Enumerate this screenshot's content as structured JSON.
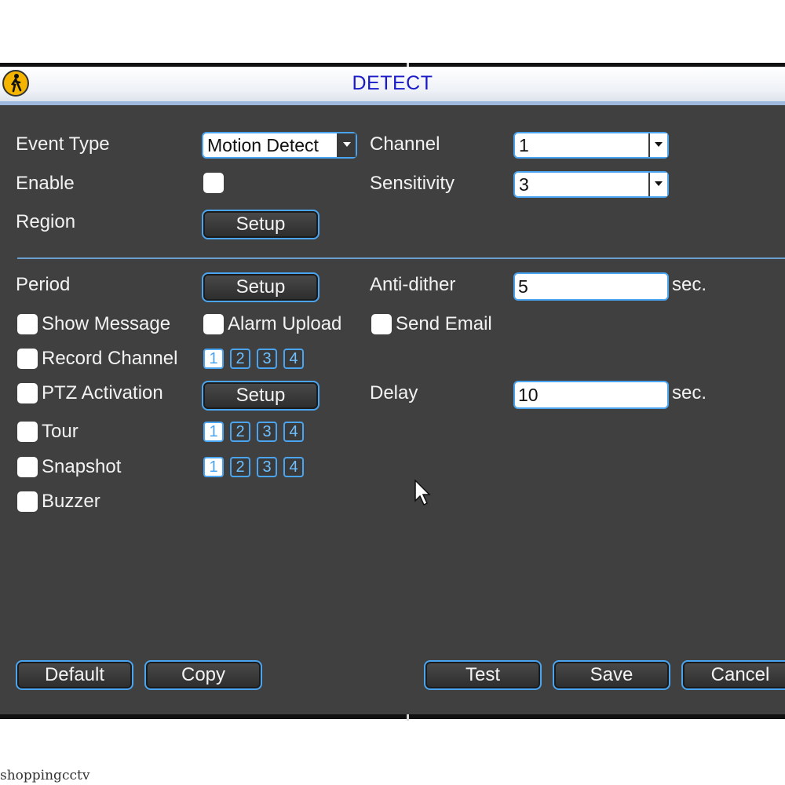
{
  "window": {
    "title": "DETECT"
  },
  "event_type": {
    "label": "Event Type",
    "value": "Motion Detect"
  },
  "channel": {
    "label": "Channel",
    "value": "1"
  },
  "enable": {
    "label": "Enable",
    "checked": false
  },
  "sensitivity": {
    "label": "Sensitivity",
    "value": "3"
  },
  "region": {
    "label": "Region",
    "button": "Setup"
  },
  "period": {
    "label": "Period",
    "button": "Setup"
  },
  "anti_dither": {
    "label": "Anti-dither",
    "value": "5",
    "unit": "sec."
  },
  "show_message": {
    "label": "Show Message",
    "checked": false
  },
  "alarm_upload": {
    "label": "Alarm Upload",
    "checked": false
  },
  "send_email": {
    "label": "Send Email",
    "checked": false
  },
  "record_channel": {
    "label": "Record Channel",
    "checked": false,
    "channels": [
      "1",
      "2",
      "3",
      "4"
    ],
    "selected": [
      "1"
    ]
  },
  "ptz_activation": {
    "label": "PTZ Activation",
    "button": "Setup"
  },
  "delay": {
    "label": "Delay",
    "value": "10",
    "unit": "sec."
  },
  "tour": {
    "label": "Tour",
    "checked": false,
    "channels": [
      "1",
      "2",
      "3",
      "4"
    ],
    "selected": [
      "1"
    ]
  },
  "snapshot": {
    "label": "Snapshot",
    "checked": false,
    "channels": [
      "1",
      "2",
      "3",
      "4"
    ],
    "selected": [
      "1"
    ]
  },
  "buzzer": {
    "label": "Buzzer",
    "checked": false
  },
  "buttons": {
    "default": "Default",
    "copy": "Copy",
    "test": "Test",
    "save": "Save",
    "cancel": "Cancel"
  },
  "watermark": "shoppingcctv",
  "colors": {
    "panel": "#404040",
    "accent": "#4aa4f0",
    "title": "#1a1ac8"
  }
}
